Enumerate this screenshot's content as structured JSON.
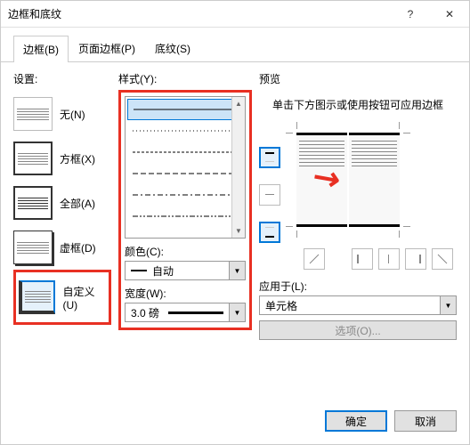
{
  "window": {
    "title": "边框和底纹"
  },
  "tabs": {
    "border": "边框(B)",
    "page": "页面边框(P)",
    "shading": "底纹(S)"
  },
  "settings": {
    "label": "设置:",
    "none": "无(N)",
    "box": "方框(X)",
    "all": "全部(A)",
    "grid": "虚框(D)",
    "custom": "自定义(U)"
  },
  "style": {
    "label": "样式(Y):",
    "color_label": "颜色(C):",
    "color_value": "自动",
    "width_label": "宽度(W):",
    "width_value": "3.0 磅"
  },
  "preview": {
    "label": "预览",
    "hint": "单击下方图示或使用按钮可应用边框",
    "apply_label": "应用于(L):",
    "apply_value": "单元格",
    "options": "选项(O)..."
  },
  "footer": {
    "ok": "确定",
    "cancel": "取消"
  }
}
